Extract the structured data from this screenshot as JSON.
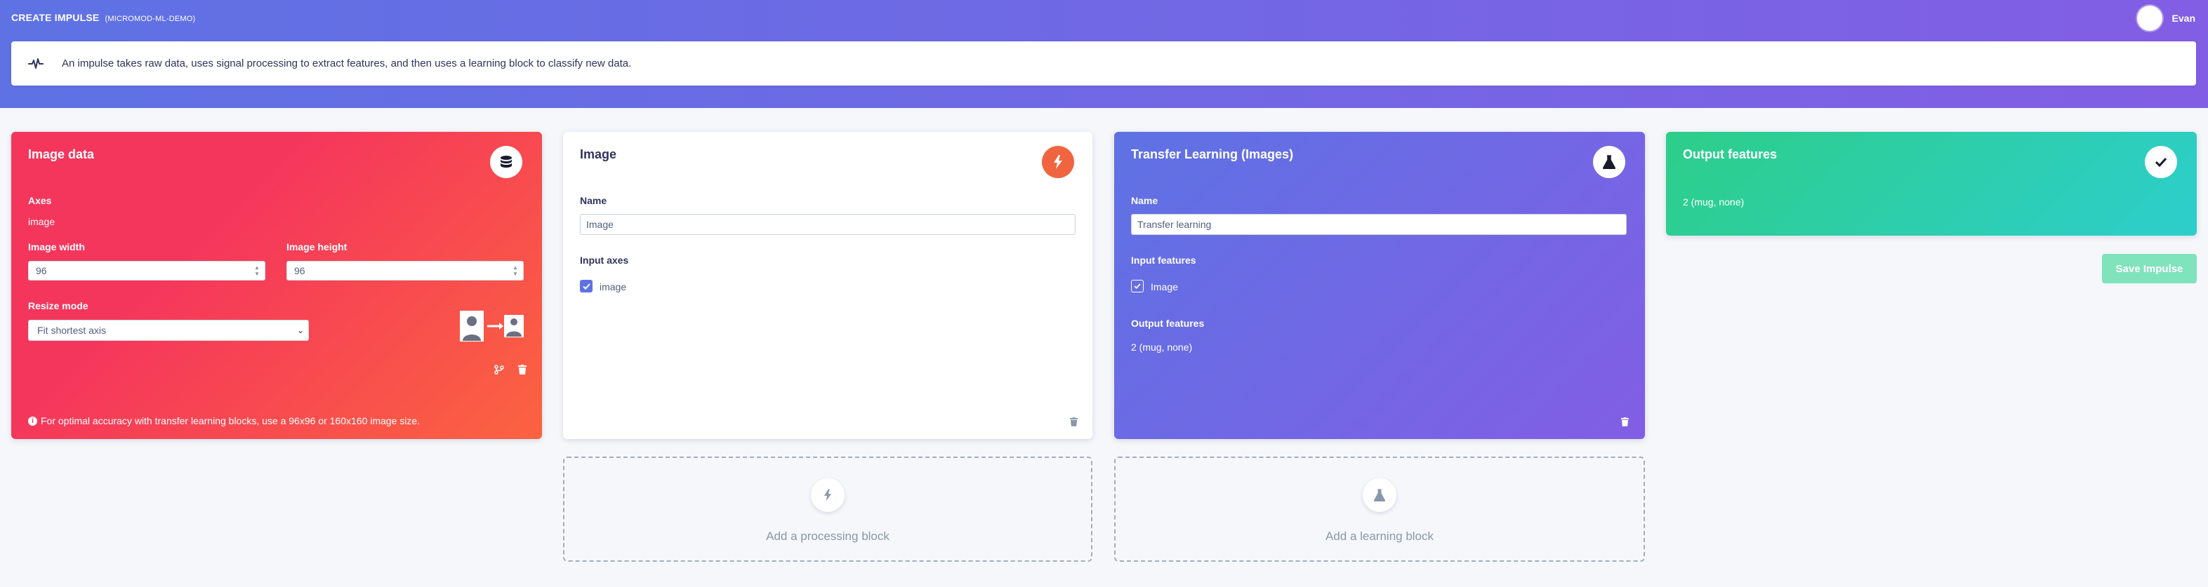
{
  "header": {
    "title": "CREATE IMPULSE",
    "project": "(MICROMOD-ML-DEMO)",
    "user_name": "Evan"
  },
  "info": {
    "text": "An impulse takes raw data, uses signal processing to extract features, and then uses a learning block to classify new data.",
    "icon": "pulse-icon"
  },
  "image_data_block": {
    "title": "Image data",
    "axes_label": "Axes",
    "axes_value": "image",
    "width_label": "Image width",
    "width_value": "96",
    "height_label": "Image height",
    "height_value": "96",
    "resize_label": "Resize mode",
    "resize_value": "Fit shortest axis",
    "note": "For optimal accuracy with transfer learning blocks, use a 96x96 or 160x160 image size.",
    "icon": "database-icon"
  },
  "processing_block": {
    "title": "Image",
    "name_label": "Name",
    "name_value": "Image",
    "input_axes_label": "Input axes",
    "axis_option": "image",
    "icon": "bolt-icon"
  },
  "learning_block": {
    "title": "Transfer Learning (Images)",
    "name_label": "Name",
    "name_value": "Transfer learning",
    "input_features_label": "Input features",
    "input_feature_option": "Image",
    "output_features_label": "Output features",
    "output_features_value": "2 (mug, none)",
    "icon": "flask-icon"
  },
  "output_block": {
    "title": "Output features",
    "value": "2 (mug, none)",
    "icon": "check-icon"
  },
  "actions": {
    "add_processing": "Add a processing block",
    "add_learning": "Add a learning block",
    "save": "Save Impulse"
  },
  "colors": {
    "hero_start": "#5e72e4",
    "hero_end": "#825ee4",
    "image_data_start": "#f5365c",
    "image_data_end": "#fb6340",
    "output_start": "#2dce89",
    "output_end": "#2dcecc",
    "save_button": "#7fe3bb"
  }
}
